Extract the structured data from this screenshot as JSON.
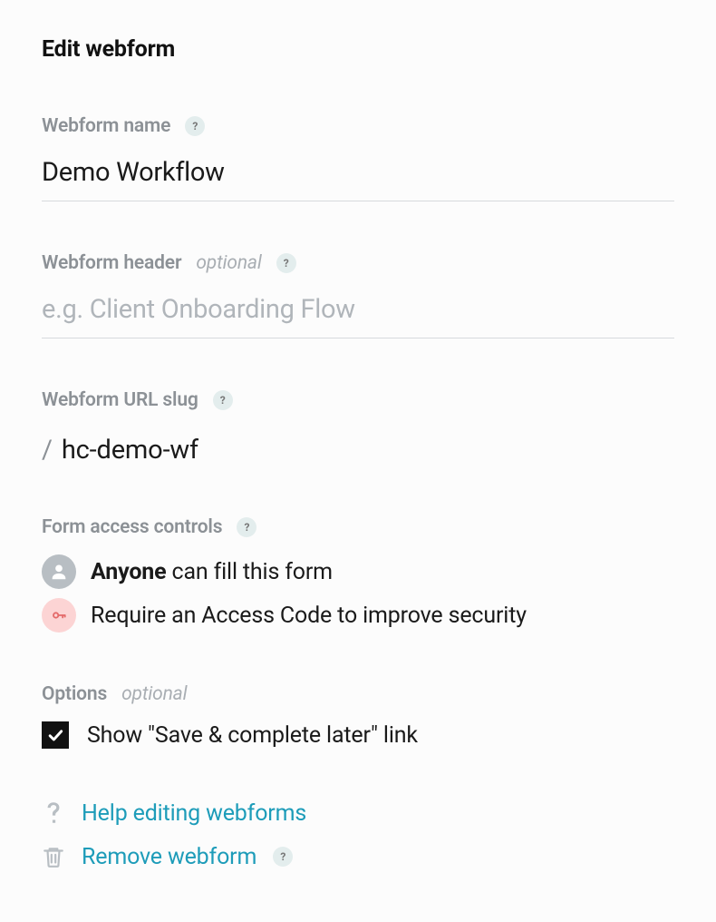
{
  "page_title": "Edit webform",
  "fields": {
    "name": {
      "label": "Webform name",
      "value": "Demo Workflow"
    },
    "header": {
      "label": "Webform header",
      "optional": "optional",
      "placeholder": "e.g. Client Onboarding Flow",
      "value": ""
    },
    "slug": {
      "label": "Webform URL slug",
      "slash": "/",
      "value": "hc-demo-wf"
    }
  },
  "access": {
    "label": "Form access controls",
    "anyone_bold": "Anyone",
    "anyone_rest": " can fill this form",
    "require_code": "Require an Access Code to improve security"
  },
  "options": {
    "label": "Options",
    "optional": "optional",
    "save_later": "Show \"Save & complete later\" link"
  },
  "footer": {
    "help": "Help editing webforms",
    "remove": "Remove webform"
  },
  "help_badge_char": "?"
}
